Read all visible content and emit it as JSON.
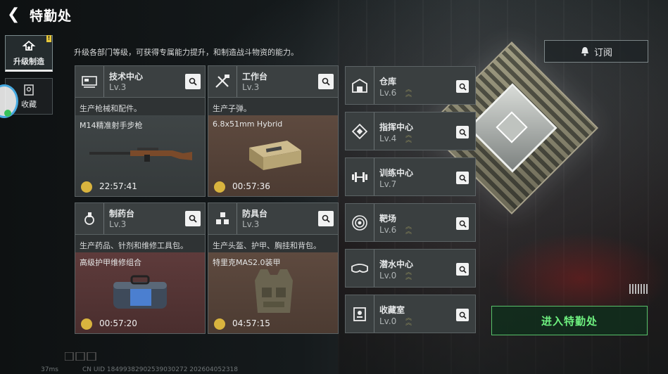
{
  "header": {
    "title": "特勤处",
    "back_icon": "back-arrow-icon"
  },
  "rail": {
    "tabs": [
      {
        "label": "升级制造",
        "icon": "upgrade-icon",
        "active": true,
        "badge": "!"
      },
      {
        "label": "收藏",
        "icon": "collection-icon",
        "active": false
      }
    ]
  },
  "description": "升级各部门等级，可获得专属能力提升，和制造战斗物资的能力。",
  "subscribe": {
    "label": "订阅",
    "icon": "bell-icon"
  },
  "workshops": [
    {
      "name": "技术中心",
      "level": "Lv.3",
      "desc": "生产枪械和配件。",
      "item": "M14精准射手步枪",
      "timer": "22:57:41",
      "icon": "tech-center-icon",
      "art": "rifle-image",
      "bg": "gray"
    },
    {
      "name": "工作台",
      "level": "Lv.3",
      "desc": "生产子弹。",
      "item": "6.8x51mm Hybrid",
      "timer": "00:57:36",
      "icon": "workbench-icon",
      "art": "ammo-box-image",
      "bg": "brown"
    },
    {
      "name": "制药台",
      "level": "Lv.3",
      "desc": "生产药品、针剂和维修工具包。",
      "item": "高级护甲维修组合",
      "timer": "00:57:20",
      "icon": "pharmacy-icon",
      "art": "repair-kit-image",
      "bg": "red"
    },
    {
      "name": "防具台",
      "level": "Lv.3",
      "desc": "生产头盔、护甲、胸挂和背包。",
      "item": "特里克MAS2.0装甲",
      "timer": "04:57:15",
      "icon": "armor-bench-icon",
      "art": "armor-vest-image",
      "bg": "brown"
    }
  ],
  "departments": [
    {
      "name": "仓库",
      "level": "Lv.6",
      "icon": "warehouse-icon",
      "upgrade": true
    },
    {
      "name": "指挥中心",
      "level": "Lv.4",
      "icon": "command-center-icon",
      "upgrade": true
    },
    {
      "name": "训练中心",
      "level": "Lv.7",
      "icon": "training-icon",
      "upgrade": false
    },
    {
      "name": "靶场",
      "level": "Lv.6",
      "icon": "target-icon",
      "upgrade": true
    },
    {
      "name": "潜水中心",
      "level": "Lv.0",
      "icon": "diving-icon",
      "upgrade": true
    },
    {
      "name": "收藏室",
      "level": "Lv.0",
      "icon": "collection-room-icon",
      "upgrade": true
    }
  ],
  "enter_button": "进入特勤处",
  "footer": {
    "ping": "37ms",
    "uid": "CN UID 18499382902539030272 202604052318"
  },
  "colors": {
    "accent_green": "#6ef07f",
    "timer_gold": "#d9b43e",
    "badge_yellow": "#e8c83a"
  }
}
